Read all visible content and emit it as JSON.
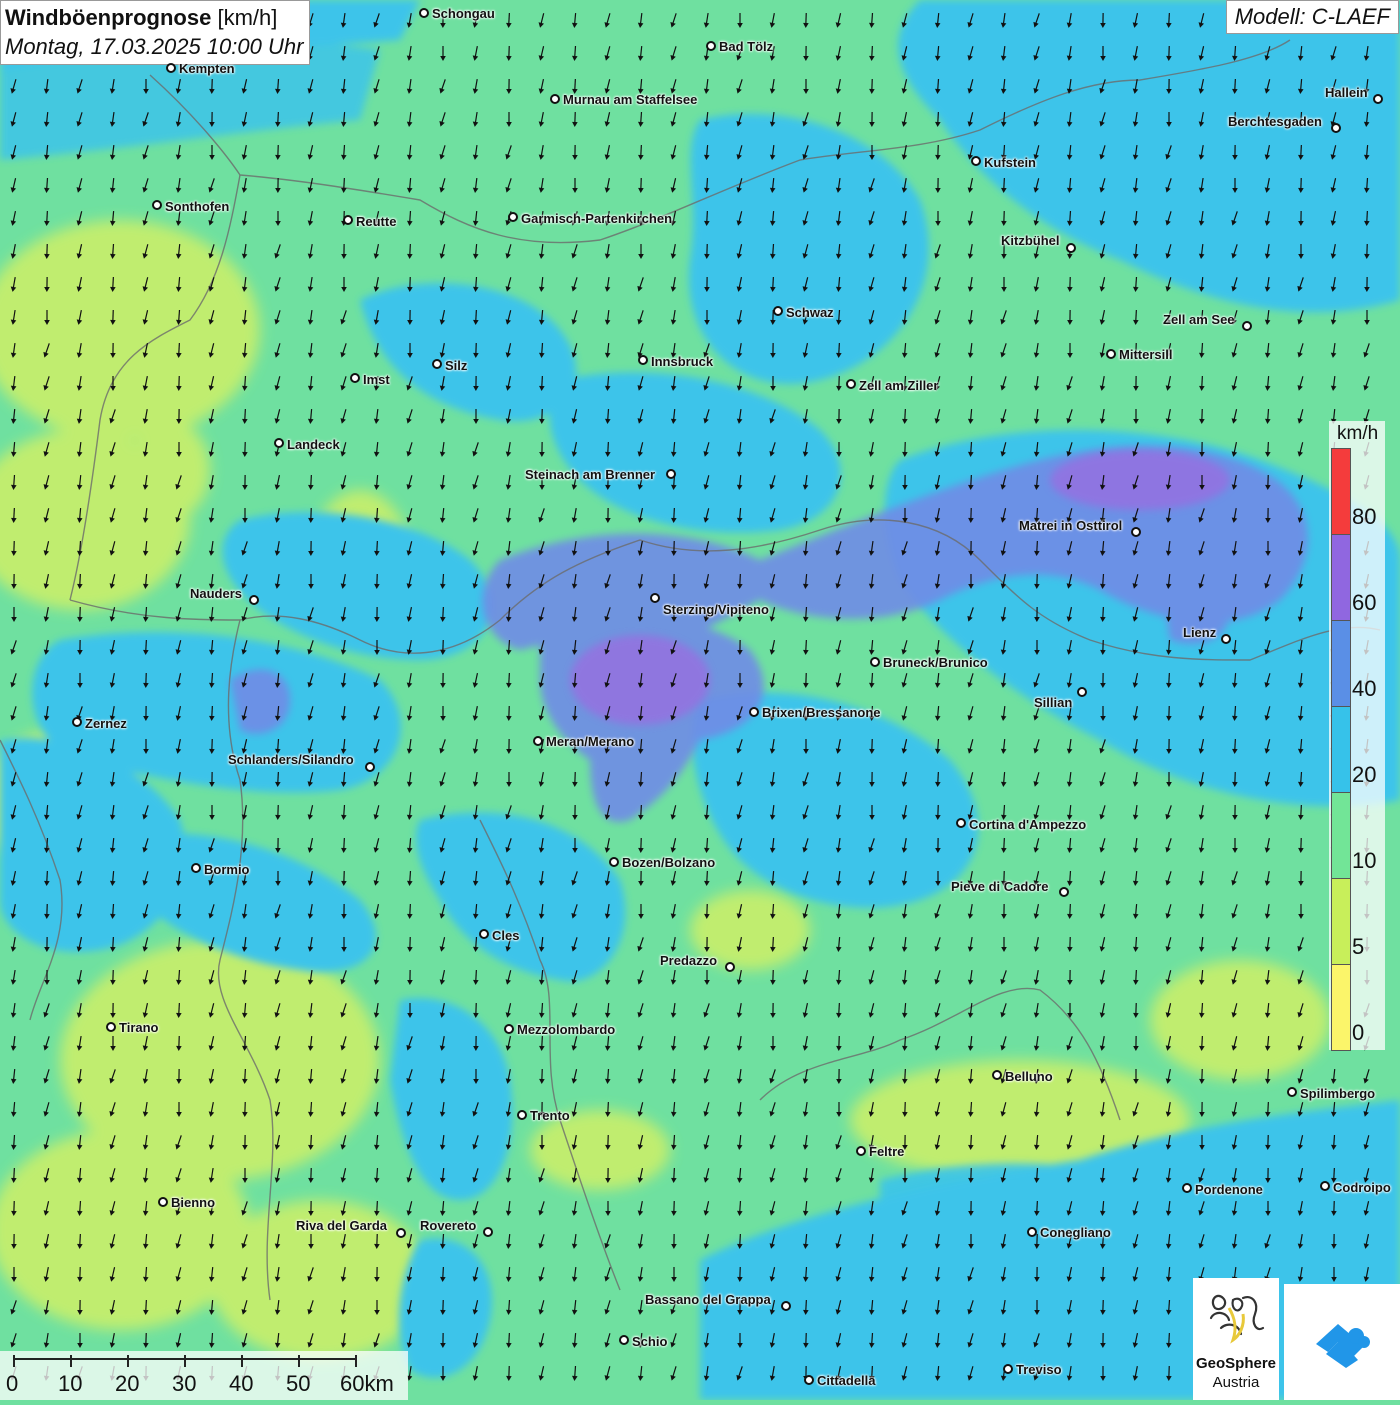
{
  "title": {
    "main": "Windböenprognose",
    "unit": "[km/h]",
    "datetime": "Montag, 17.03.2025 10:00 Uhr"
  },
  "model": "Modell: C-LAEF",
  "legend": {
    "unit": "km/h",
    "bands": [
      {
        "label": "0",
        "color": "#fbf56a"
      },
      {
        "label": "5",
        "color": "#c8ef5a"
      },
      {
        "label": "10",
        "color": "#72e597"
      },
      {
        "label": "20",
        "color": "#36c2ea"
      },
      {
        "label": "40",
        "color": "#5a8fe6"
      },
      {
        "label": "60",
        "color": "#9067e0"
      },
      {
        "label": "80",
        "color": "#f43c3c"
      }
    ],
    "tick_labels": [
      "0",
      "5",
      "10",
      "20",
      "40",
      "60",
      "80"
    ]
  },
  "scalebar": {
    "labels": [
      "0",
      "10",
      "20",
      "30",
      "40",
      "50",
      "60km"
    ]
  },
  "logos": {
    "geosphere_name": "GeoSphere",
    "geosphere_sub": "Austria"
  },
  "wind_direction": "north-north-westerly (arrows pointing south)",
  "cities": [
    {
      "name": "Schongau"
    },
    {
      "name": "Bad Tölz"
    },
    {
      "name": "Kempten"
    },
    {
      "name": "Murnau am Staffelsee"
    },
    {
      "name": "Hallein"
    },
    {
      "name": "Berchtesgaden"
    },
    {
      "name": "Kufstein"
    },
    {
      "name": "Sonthofen"
    },
    {
      "name": "Reutte"
    },
    {
      "name": "Garmisch-Partenkirchen"
    },
    {
      "name": "Kitzbühel"
    },
    {
      "name": "Schwaz"
    },
    {
      "name": "Zell am See"
    },
    {
      "name": "Mittersill"
    },
    {
      "name": "Imst"
    },
    {
      "name": "Silz"
    },
    {
      "name": "Innsbruck"
    },
    {
      "name": "Zell am Ziller"
    },
    {
      "name": "Landeck"
    },
    {
      "name": "Steinach am Brenner"
    },
    {
      "name": "Matrei in Osttirol"
    },
    {
      "name": "Nauders"
    },
    {
      "name": "Sterzing/Vipiteno"
    },
    {
      "name": "Lienz"
    },
    {
      "name": "Bruneck/Brunico"
    },
    {
      "name": "Sillian"
    },
    {
      "name": "Zernez"
    },
    {
      "name": "Brixen/Bressanone"
    },
    {
      "name": "Meran/Merano"
    },
    {
      "name": "Schlanders/Silandro"
    },
    {
      "name": "Cortina d'Ampezzo"
    },
    {
      "name": "Bozen/Bolzano"
    },
    {
      "name": "Bormio"
    },
    {
      "name": "Pieve di Cadore"
    },
    {
      "name": "Cles"
    },
    {
      "name": "Predazzo"
    },
    {
      "name": "Tirano"
    },
    {
      "name": "Mezzolombardo"
    },
    {
      "name": "Belluno"
    },
    {
      "name": "Spilimbergo"
    },
    {
      "name": "Trento"
    },
    {
      "name": "Feltre"
    },
    {
      "name": "Pordenone"
    },
    {
      "name": "Codroipo"
    },
    {
      "name": "Bienno"
    },
    {
      "name": "Riva del Garda"
    },
    {
      "name": "Rovereto"
    },
    {
      "name": "Conegliano"
    },
    {
      "name": "Bassano del Grappa"
    },
    {
      "name": "Schio"
    },
    {
      "name": "Treviso"
    },
    {
      "name": "Cittadella"
    }
  ]
}
